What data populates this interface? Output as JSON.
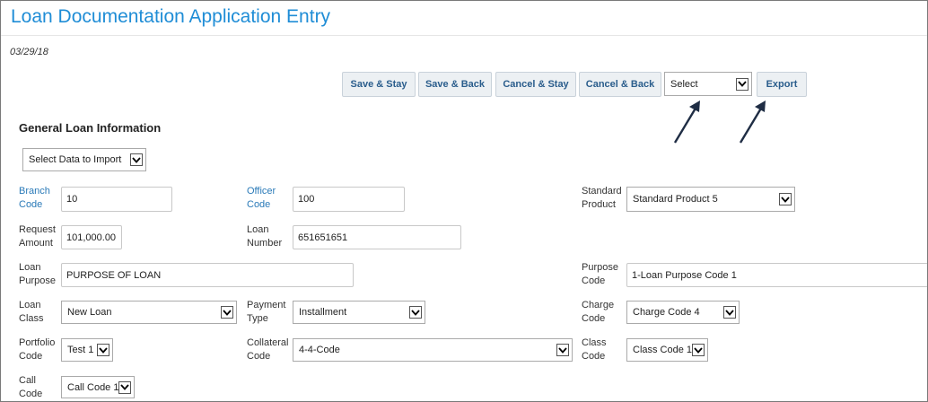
{
  "page": {
    "title": "Loan Documentation Application Entry",
    "date": "03/29/18"
  },
  "toolbar": {
    "save_stay": "Save & Stay",
    "save_back": "Save & Back",
    "cancel_stay": "Cancel & Stay",
    "cancel_back": "Cancel & Back",
    "select_value": "Select",
    "export": "Export"
  },
  "section": {
    "title": "General Loan Information",
    "import_select": "Select Data to Import"
  },
  "fields": {
    "branch_code": {
      "label1": "Branch",
      "label2": "Code",
      "value": "10"
    },
    "officer_code": {
      "label1": "Officer",
      "label2": "Code",
      "value": "100"
    },
    "standard_product": {
      "label1": "Standard",
      "label2": "Product",
      "value": "Standard Product 5"
    },
    "request_amount": {
      "label1": "Request",
      "label2": "Amount",
      "value": "101,000.00"
    },
    "loan_number": {
      "label1": "Loan",
      "label2": "Number",
      "value": "651651651"
    },
    "loan_purpose": {
      "label1": "Loan",
      "label2": "Purpose",
      "value": "PURPOSE OF LOAN"
    },
    "purpose_code": {
      "label1": "Purpose",
      "label2": "Code",
      "value": "1-Loan Purpose Code 1"
    },
    "loan_class": {
      "label1": "Loan",
      "label2": "Class",
      "value": "New Loan"
    },
    "payment_type": {
      "label1": "Payment",
      "label2": "Type",
      "value": "Installment"
    },
    "charge_code": {
      "label1": "Charge",
      "label2": "Code",
      "value": "Charge Code 4"
    },
    "portfolio_code": {
      "label1": "Portfolio",
      "label2": "Code",
      "value": "Test 1"
    },
    "collateral_code": {
      "label1": "Collateral",
      "label2": "Code",
      "value": "4-4-Code"
    },
    "class_code": {
      "label1": "Class",
      "label2": "Code",
      "value": "Class Code 1"
    },
    "call_code": {
      "label1": "Call",
      "label2": "Code",
      "value": "Call Code 1"
    }
  },
  "icons": {
    "dropdown": "chevron-down-icon",
    "annotation": "arrow-icon"
  },
  "colors": {
    "title": "#1f8dd6",
    "link_label": "#2a7ab8",
    "button_text": "#2a5d8c",
    "button_bg": "#ecf0f3",
    "arrow": "#1f2d44"
  }
}
